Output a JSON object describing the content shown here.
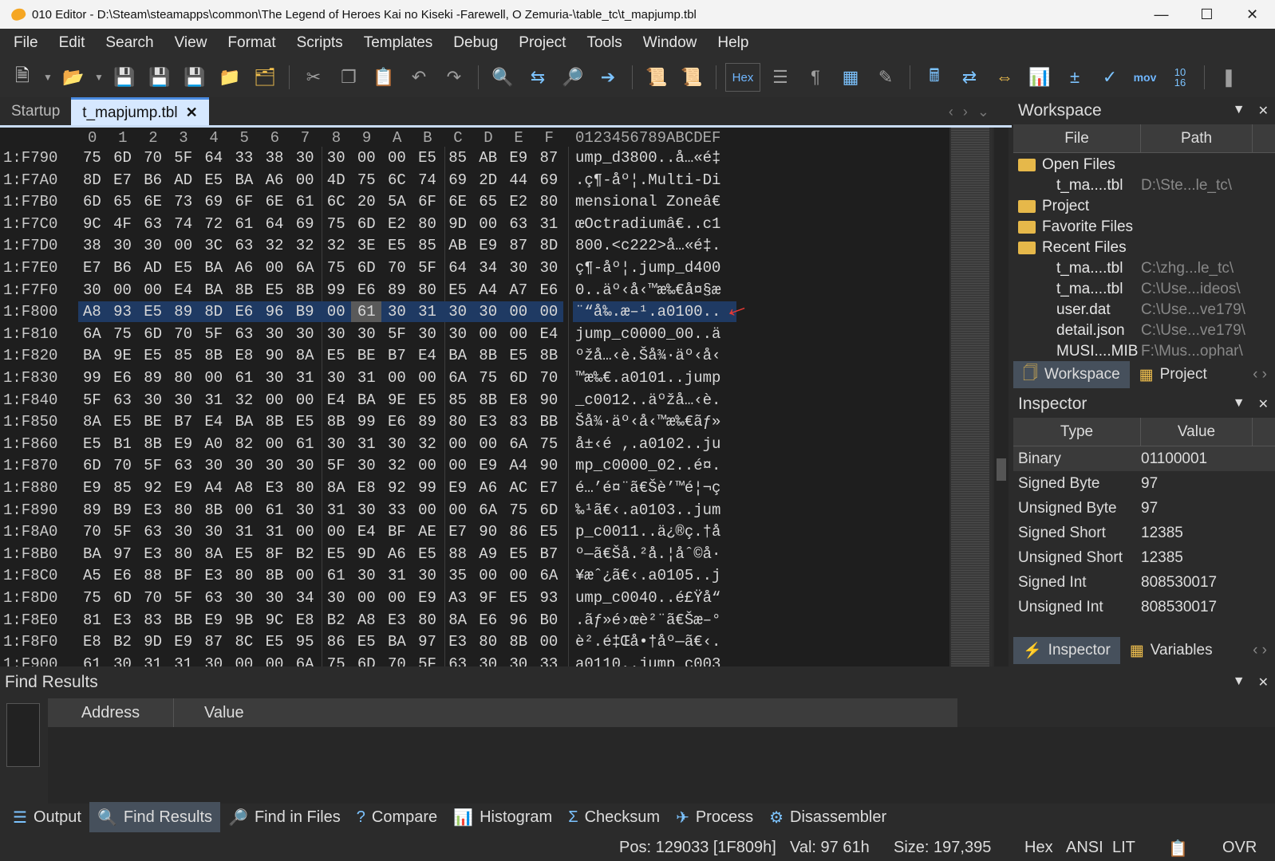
{
  "window": {
    "title": "010 Editor - D:\\Steam\\steamapps\\common\\The Legend of Heroes Kai no Kiseki -Farewell, O Zemuria-\\table_tc\\t_mapjump.tbl"
  },
  "menu": [
    "File",
    "Edit",
    "Search",
    "View",
    "Format",
    "Scripts",
    "Templates",
    "Debug",
    "Project",
    "Tools",
    "Window",
    "Help"
  ],
  "toolbar": {
    "hex_label": "Hex",
    "mov_label": "mov",
    "num_label": "10\n16"
  },
  "tabs": [
    {
      "label": "Startup"
    },
    {
      "label": "t_mapjump.tbl"
    }
  ],
  "hex": {
    "columns": [
      "0",
      "1",
      "2",
      "3",
      "4",
      "5",
      "6",
      "7",
      "8",
      "9",
      "A",
      "B",
      "C",
      "D",
      "E",
      "F"
    ],
    "ascii_header": "0123456789ABCDEF",
    "rows": [
      {
        "addr": "1:F790",
        "bytes": [
          "75",
          "6D",
          "70",
          "5F",
          "64",
          "33",
          "38",
          "30",
          "30",
          "00",
          "00",
          "E5",
          "85",
          "AB",
          "E9",
          "87"
        ],
        "ascii": "ump_d3800..å…«é‡"
      },
      {
        "addr": "1:F7A0",
        "bytes": [
          "8D",
          "E7",
          "B6",
          "AD",
          "E5",
          "BA",
          "A6",
          "00",
          "4D",
          "75",
          "6C",
          "74",
          "69",
          "2D",
          "44",
          "69"
        ],
        "ascii": ".ç¶-åº¦.Multi-Di"
      },
      {
        "addr": "1:F7B0",
        "bytes": [
          "6D",
          "65",
          "6E",
          "73",
          "69",
          "6F",
          "6E",
          "61",
          "6C",
          "20",
          "5A",
          "6F",
          "6E",
          "65",
          "E2",
          "80"
        ],
        "ascii": "mensional Zoneâ€"
      },
      {
        "addr": "1:F7C0",
        "bytes": [
          "9C",
          "4F",
          "63",
          "74",
          "72",
          "61",
          "64",
          "69",
          "75",
          "6D",
          "E2",
          "80",
          "9D",
          "00",
          "63",
          "31"
        ],
        "ascii": "œOctradiumâ€..c1"
      },
      {
        "addr": "1:F7D0",
        "bytes": [
          "38",
          "30",
          "30",
          "00",
          "3C",
          "63",
          "32",
          "32",
          "32",
          "3E",
          "E5",
          "85",
          "AB",
          "E9",
          "87",
          "8D"
        ],
        "ascii": "800.<c222>å…«é‡."
      },
      {
        "addr": "1:F7E0",
        "bytes": [
          "E7",
          "B6",
          "AD",
          "E5",
          "BA",
          "A6",
          "00",
          "6A",
          "75",
          "6D",
          "70",
          "5F",
          "64",
          "34",
          "30",
          "30"
        ],
        "ascii": "ç¶-åº¦.jump_d400"
      },
      {
        "addr": "1:F7F0",
        "bytes": [
          "30",
          "00",
          "00",
          "E4",
          "BA",
          "8B",
          "E5",
          "8B",
          "99",
          "E6",
          "89",
          "80",
          "E5",
          "A4",
          "A7",
          "E6"
        ],
        "ascii": "0..äº‹å‹™æ‰€å¤§æ"
      },
      {
        "addr": "1:F800",
        "bytes": [
          "A8",
          "93",
          "E5",
          "89",
          "8D",
          "E6",
          "96",
          "B9",
          "00",
          "61",
          "30",
          "31",
          "30",
          "30",
          "00",
          "00"
        ],
        "ascii": "¨“å‰.æ–¹.a0100..",
        "selected": true
      },
      {
        "addr": "1:F810",
        "bytes": [
          "6A",
          "75",
          "6D",
          "70",
          "5F",
          "63",
          "30",
          "30",
          "30",
          "30",
          "5F",
          "30",
          "30",
          "00",
          "00",
          "E4"
        ],
        "ascii": "jump_c0000_00..ä"
      },
      {
        "addr": "1:F820",
        "bytes": [
          "BA",
          "9E",
          "E5",
          "85",
          "8B",
          "E8",
          "90",
          "8A",
          "E5",
          "BE",
          "B7",
          "E4",
          "BA",
          "8B",
          "E5",
          "8B"
        ],
        "ascii": "ºžå…‹è.Šå¾·äº‹å‹"
      },
      {
        "addr": "1:F830",
        "bytes": [
          "99",
          "E6",
          "89",
          "80",
          "00",
          "61",
          "30",
          "31",
          "30",
          "31",
          "00",
          "00",
          "6A",
          "75",
          "6D",
          "70"
        ],
        "ascii": "™æ‰€.a0101..jump"
      },
      {
        "addr": "1:F840",
        "bytes": [
          "5F",
          "63",
          "30",
          "30",
          "31",
          "32",
          "00",
          "00",
          "E4",
          "BA",
          "9E",
          "E5",
          "85",
          "8B",
          "E8",
          "90"
        ],
        "ascii": "_c0012..äºžå…‹è."
      },
      {
        "addr": "1:F850",
        "bytes": [
          "8A",
          "E5",
          "BE",
          "B7",
          "E4",
          "BA",
          "8B",
          "E5",
          "8B",
          "99",
          "E6",
          "89",
          "80",
          "E3",
          "83",
          "BB"
        ],
        "ascii": "Šå¾·äº‹å‹™æ‰€ãƒ»"
      },
      {
        "addr": "1:F860",
        "bytes": [
          "E5",
          "B1",
          "8B",
          "E9",
          "A0",
          "82",
          "00",
          "61",
          "30",
          "31",
          "30",
          "32",
          "00",
          "00",
          "6A",
          "75"
        ],
        "ascii": "å±‹é ‚.a0102..ju"
      },
      {
        "addr": "1:F870",
        "bytes": [
          "6D",
          "70",
          "5F",
          "63",
          "30",
          "30",
          "30",
          "30",
          "5F",
          "30",
          "32",
          "00",
          "00",
          "E9",
          "A4",
          "90"
        ],
        "ascii": "mp_c0000_02..é¤."
      },
      {
        "addr": "1:F880",
        "bytes": [
          "E9",
          "85",
          "92",
          "E9",
          "A4",
          "A8",
          "E3",
          "80",
          "8A",
          "E8",
          "92",
          "99",
          "E9",
          "A6",
          "AC",
          "E7"
        ],
        "ascii": "é…’é¤¨ã€Šè’™é¦¬ç"
      },
      {
        "addr": "1:F890",
        "bytes": [
          "89",
          "B9",
          "E3",
          "80",
          "8B",
          "00",
          "61",
          "30",
          "31",
          "30",
          "33",
          "00",
          "00",
          "6A",
          "75",
          "6D"
        ],
        "ascii": "‰¹ã€‹.a0103..jum"
      },
      {
        "addr": "1:F8A0",
        "bytes": [
          "70",
          "5F",
          "63",
          "30",
          "30",
          "31",
          "31",
          "00",
          "00",
          "E4",
          "BF",
          "AE",
          "E7",
          "90",
          "86",
          "E5"
        ],
        "ascii": "p_c0011..ä¿®ç.†å"
      },
      {
        "addr": "1:F8B0",
        "bytes": [
          "BA",
          "97",
          "E3",
          "80",
          "8A",
          "E5",
          "8F",
          "B2",
          "E5",
          "9D",
          "A6",
          "E5",
          "88",
          "A9",
          "E5",
          "B7"
        ],
        "ascii": "º—ã€Šå.²å.¦åˆ©å·"
      },
      {
        "addr": "1:F8C0",
        "bytes": [
          "A5",
          "E6",
          "88",
          "BF",
          "E3",
          "80",
          "8B",
          "00",
          "61",
          "30",
          "31",
          "30",
          "35",
          "00",
          "00",
          "6A"
        ],
        "ascii": "¥æˆ¿ã€‹.a0105..j"
      },
      {
        "addr": "1:F8D0",
        "bytes": [
          "75",
          "6D",
          "70",
          "5F",
          "63",
          "30",
          "30",
          "34",
          "30",
          "00",
          "00",
          "E9",
          "A3",
          "9F",
          "E5",
          "93"
        ],
        "ascii": "ump_c0040..é£Ÿå“"
      },
      {
        "addr": "1:F8E0",
        "bytes": [
          "81",
          "E3",
          "83",
          "BB",
          "E9",
          "9B",
          "9C",
          "E8",
          "B2",
          "A8",
          "E3",
          "80",
          "8A",
          "E6",
          "96",
          "B0"
        ],
        "ascii": ".ãƒ»é›œè²¨ã€Šæ–°"
      },
      {
        "addr": "1:F8F0",
        "bytes": [
          "E8",
          "B2",
          "9D",
          "E9",
          "87",
          "8C",
          "E5",
          "95",
          "86",
          "E5",
          "BA",
          "97",
          "E3",
          "80",
          "8B",
          "00"
        ],
        "ascii": "è².é‡Œå•†åº—ã€‹."
      },
      {
        "addr": "1:F900",
        "bytes": [
          "61",
          "30",
          "31",
          "31",
          "30",
          "00",
          "00",
          "6A",
          "75",
          "6D",
          "70",
          "5F",
          "63",
          "30",
          "30",
          "33"
        ],
        "ascii": "a0110..jump_c003"
      }
    ]
  },
  "workspace": {
    "title": "Workspace",
    "col_file": "File",
    "col_path": "Path",
    "items": [
      {
        "name": "Open Files",
        "path": "",
        "folder": true
      },
      {
        "name": "t_ma....tbl",
        "path": "D:\\Ste...le_tc\\",
        "folder": false
      },
      {
        "name": "Project",
        "path": "",
        "folder": true
      },
      {
        "name": "Favorite Files",
        "path": "",
        "folder": true
      },
      {
        "name": "Recent Files",
        "path": "",
        "folder": true
      },
      {
        "name": "t_ma....tbl",
        "path": "C:\\zhg...le_tc\\",
        "folder": false
      },
      {
        "name": "t_ma....tbl",
        "path": "C:\\Use...ideos\\",
        "folder": false
      },
      {
        "name": "user.dat",
        "path": "C:\\Use...ve179\\",
        "folder": false
      },
      {
        "name": "detail.json",
        "path": "C:\\Use...ve179\\",
        "folder": false
      },
      {
        "name": "MUSI....MIB",
        "path": "F:\\Mus...ophar\\",
        "folder": false
      }
    ],
    "tabs": [
      "Workspace",
      "Project"
    ]
  },
  "inspector": {
    "title": "Inspector",
    "col_type": "Type",
    "col_value": "Value",
    "rows": [
      {
        "type": "Binary",
        "value": "01100001"
      },
      {
        "type": "Signed Byte",
        "value": "97"
      },
      {
        "type": "Unsigned Byte",
        "value": "97"
      },
      {
        "type": "Signed Short",
        "value": "12385"
      },
      {
        "type": "Unsigned Short",
        "value": "12385"
      },
      {
        "type": "Signed Int",
        "value": "808530017"
      },
      {
        "type": "Unsigned Int",
        "value": "808530017"
      }
    ],
    "tabs": [
      "Inspector",
      "Variables"
    ]
  },
  "find_results": {
    "title": "Find Results",
    "col_address": "Address",
    "col_value": "Value"
  },
  "bottom_tabs": [
    "Output",
    "Find Results",
    "Find in Files",
    "Compare",
    "Histogram",
    "Checksum",
    "Process",
    "Disassembler"
  ],
  "status": {
    "pos": "Pos: 129033 [1F809h]",
    "val": "Val: 97 61h",
    "size": "Size: 197,395",
    "mode": "Hex",
    "enc": "ANSI",
    "endian": "LIT",
    "ovr": "OVR"
  }
}
